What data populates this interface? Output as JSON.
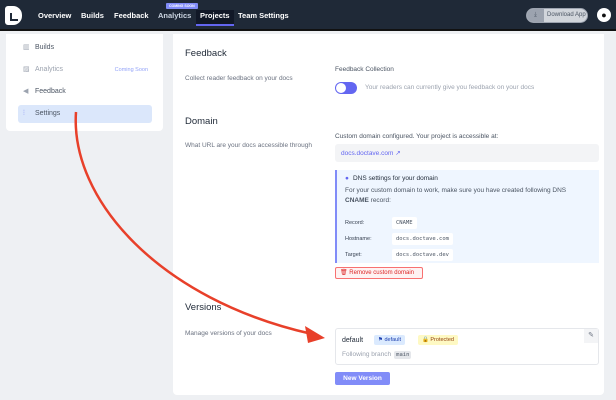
{
  "nav": {
    "items": [
      "Overview",
      "Builds",
      "Feedback",
      "Analytics",
      "Projects",
      "Team Settings"
    ],
    "coming_soon": "COMING SOON",
    "download": "Download App"
  },
  "sidebar": {
    "items": [
      {
        "label": "Builds",
        "icon": "builds-icon"
      },
      {
        "label": "Analytics",
        "icon": "chart-icon",
        "badge": "Coming Soon"
      },
      {
        "label": "Feedback",
        "icon": "megaphone-icon"
      },
      {
        "label": "Settings",
        "icon": "sliders-icon"
      }
    ]
  },
  "feedback": {
    "title": "Feedback",
    "desc": "Collect reader feedback on your docs",
    "label": "Feedback Collection",
    "toggle_on": true,
    "status": "Your readers can currently give you feedback on your docs"
  },
  "domain": {
    "title": "Domain",
    "desc": "What URL are your docs accessible through",
    "configured": "Custom domain configured. Your project is accessible at:",
    "url": "docs.doctave.com",
    "dns_title": "DNS settings for your domain",
    "dns_text": "For your custom domain to work, make sure you have created following DNS",
    "dns_cname": "CNAME",
    "dns_text2": "record:",
    "rows": [
      {
        "k": "Record:",
        "v": "CNAME"
      },
      {
        "k": "Hostname:",
        "v": "docs.doctave.com"
      },
      {
        "k": "Target:",
        "v": "docs.doctave.dev"
      }
    ],
    "remove": "Remove custom domain"
  },
  "versions": {
    "title": "Versions",
    "desc": "Manage versions of your docs",
    "name": "default",
    "badge_default": "default",
    "badge_protected": "Protected",
    "following": "Following branch",
    "branch": "main",
    "new": "New Version"
  },
  "colors": {
    "accent": "#6366f1",
    "danger": "#dc2626",
    "arrow": "#e8402a"
  }
}
